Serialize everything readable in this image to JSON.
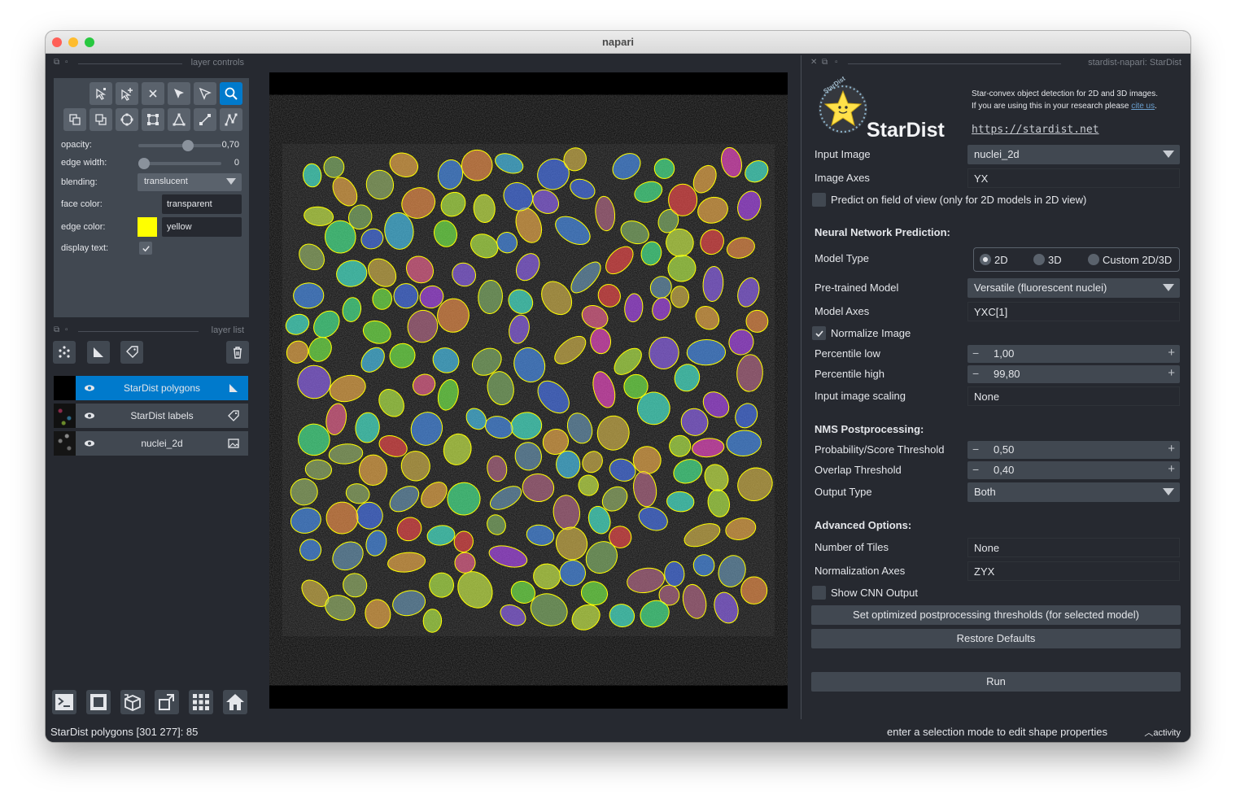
{
  "window": {
    "title": "napari"
  },
  "colors": {
    "background": "#262930",
    "panel": "#414851",
    "button": "#5a626c",
    "accent": "#007acc",
    "edge_yellow": "#ffff00"
  },
  "layer_controls": {
    "header": "layer controls",
    "tools": [
      "select-vertices-icon",
      "add-vertices-icon",
      "delete-shape-icon",
      "direct-select-icon",
      "select-icon",
      "zoom-icon",
      "move-back-icon",
      "move-front-icon",
      "ellipse-icon",
      "rectangle-icon",
      "polygon-icon",
      "line-icon",
      "path-icon"
    ],
    "opacity_label": "opacity:",
    "opacity_value": "0,70",
    "opacity_level": 0.7,
    "edge_width_label": "edge width:",
    "edge_width_value": "0",
    "blending_label": "blending:",
    "blending_value": "translucent",
    "face_color_label": "face color:",
    "face_color_value": "transparent",
    "edge_color_label": "edge color:",
    "edge_color_value": "yellow",
    "display_text_label": "display text:"
  },
  "layer_list": {
    "header": "layer list",
    "layers": [
      {
        "name": "StarDist polygons",
        "selected": true
      },
      {
        "name": "StarDist labels",
        "selected": false
      },
      {
        "name": "nuclei_2d",
        "selected": false
      }
    ]
  },
  "bottom_buttons": [
    "console-icon",
    "ndisplay-icon",
    "roll-icon",
    "transpose-icon",
    "grid-icon",
    "home-icon"
  ],
  "plugin": {
    "header": "stardist-napari: StarDist",
    "logo_text": "StarDist",
    "logo_arc": "StarDist",
    "desc1": "Star-convex object detection for 2D and 3D images.",
    "desc2": "If you are using this in your research please",
    "cite": "cite us",
    "desc_end": ".",
    "url": "https://stardist.net",
    "input_image_label": "Input Image",
    "input_image_value": "nuclei_2d",
    "image_axes_label": "Image Axes",
    "image_axes_value": "YX",
    "predict_fov_label": "Predict on field of view (only for 2D models in 2D view)",
    "nn_section": "Neural Network Prediction:",
    "model_type_label": "Model Type",
    "model_type_options": [
      "2D",
      "3D",
      "Custom 2D/3D"
    ],
    "pretrained_label": "Pre-trained Model",
    "pretrained_value": "Versatile (fluorescent nuclei)",
    "model_axes_label": "Model Axes",
    "model_axes_value": "YXC[1]",
    "normalize_label": "Normalize Image",
    "perc_low_label": "Percentile low",
    "perc_low_value": "1,00",
    "perc_high_label": "Percentile high",
    "perc_high_value": "99,80",
    "scaling_label": "Input image scaling",
    "scaling_value": "None",
    "nms_section": "NMS Postprocessing:",
    "prob_label": "Probability/Score Threshold",
    "prob_value": "0,50",
    "overlap_label": "Overlap Threshold",
    "overlap_value": "0,40",
    "output_label": "Output Type",
    "output_value": "Both",
    "adv_section": "Advanced Options:",
    "tiles_label": "Number of Tiles",
    "tiles_value": "None",
    "norm_axes_label": "Normalization Axes",
    "norm_axes_value": "ZYX",
    "cnn_label": "Show CNN Output",
    "set_opt_button": "Set optimized postprocessing thresholds (for selected model)",
    "restore_button": "Restore Defaults",
    "run_button": "Run"
  },
  "status": {
    "left": "StarDist polygons [301 277]: 85",
    "right": "enter a selection mode to edit shape properties",
    "activity": "activity"
  }
}
